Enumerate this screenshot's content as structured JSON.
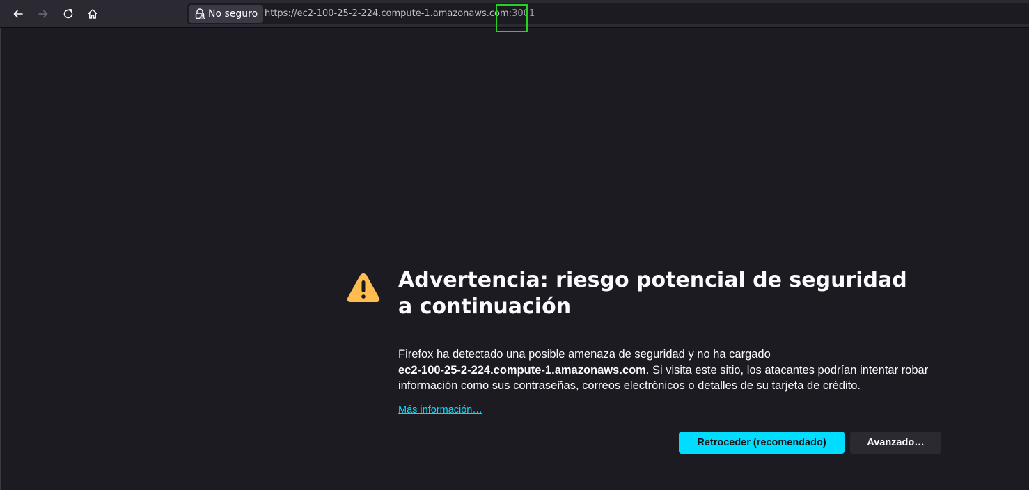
{
  "toolbar": {
    "back_icon": "arrow-left-icon",
    "forward_icon": "arrow-right-icon",
    "reload_icon": "reload-icon",
    "home_icon": "home-icon"
  },
  "urlbar": {
    "security_label": "No seguro",
    "security_icon": "insecure-lock-icon",
    "url_main": "https://ec2-100-25-2-224.compute-1.amazonaws.com",
    "url_port": ":3001"
  },
  "error_page": {
    "title": "Advertencia: riesgo potencial de seguridad a continuación",
    "desc_before": "Firefox ha detectado una posible amenaza de seguridad y no ha cargado",
    "desc_host": "ec2-100-25-2-224.compute-1.amazonaws.com",
    "desc_after": ". Si visita este sitio, los atacantes podrían intentar robar información como sus contraseñas, correos electrónicos o detalles de su tarjeta de crédito.",
    "more_info_link": "Más información…",
    "go_back_button": "Retroceder (recomendado)",
    "advanced_button": "Avanzado…",
    "warning_icon": "warning-icon"
  },
  "colors": {
    "accent": "#00ddff",
    "warning": "#ffbd4f",
    "background": "#1c1b22",
    "toolbar": "#2b2a33",
    "highlight": "#22d322"
  }
}
